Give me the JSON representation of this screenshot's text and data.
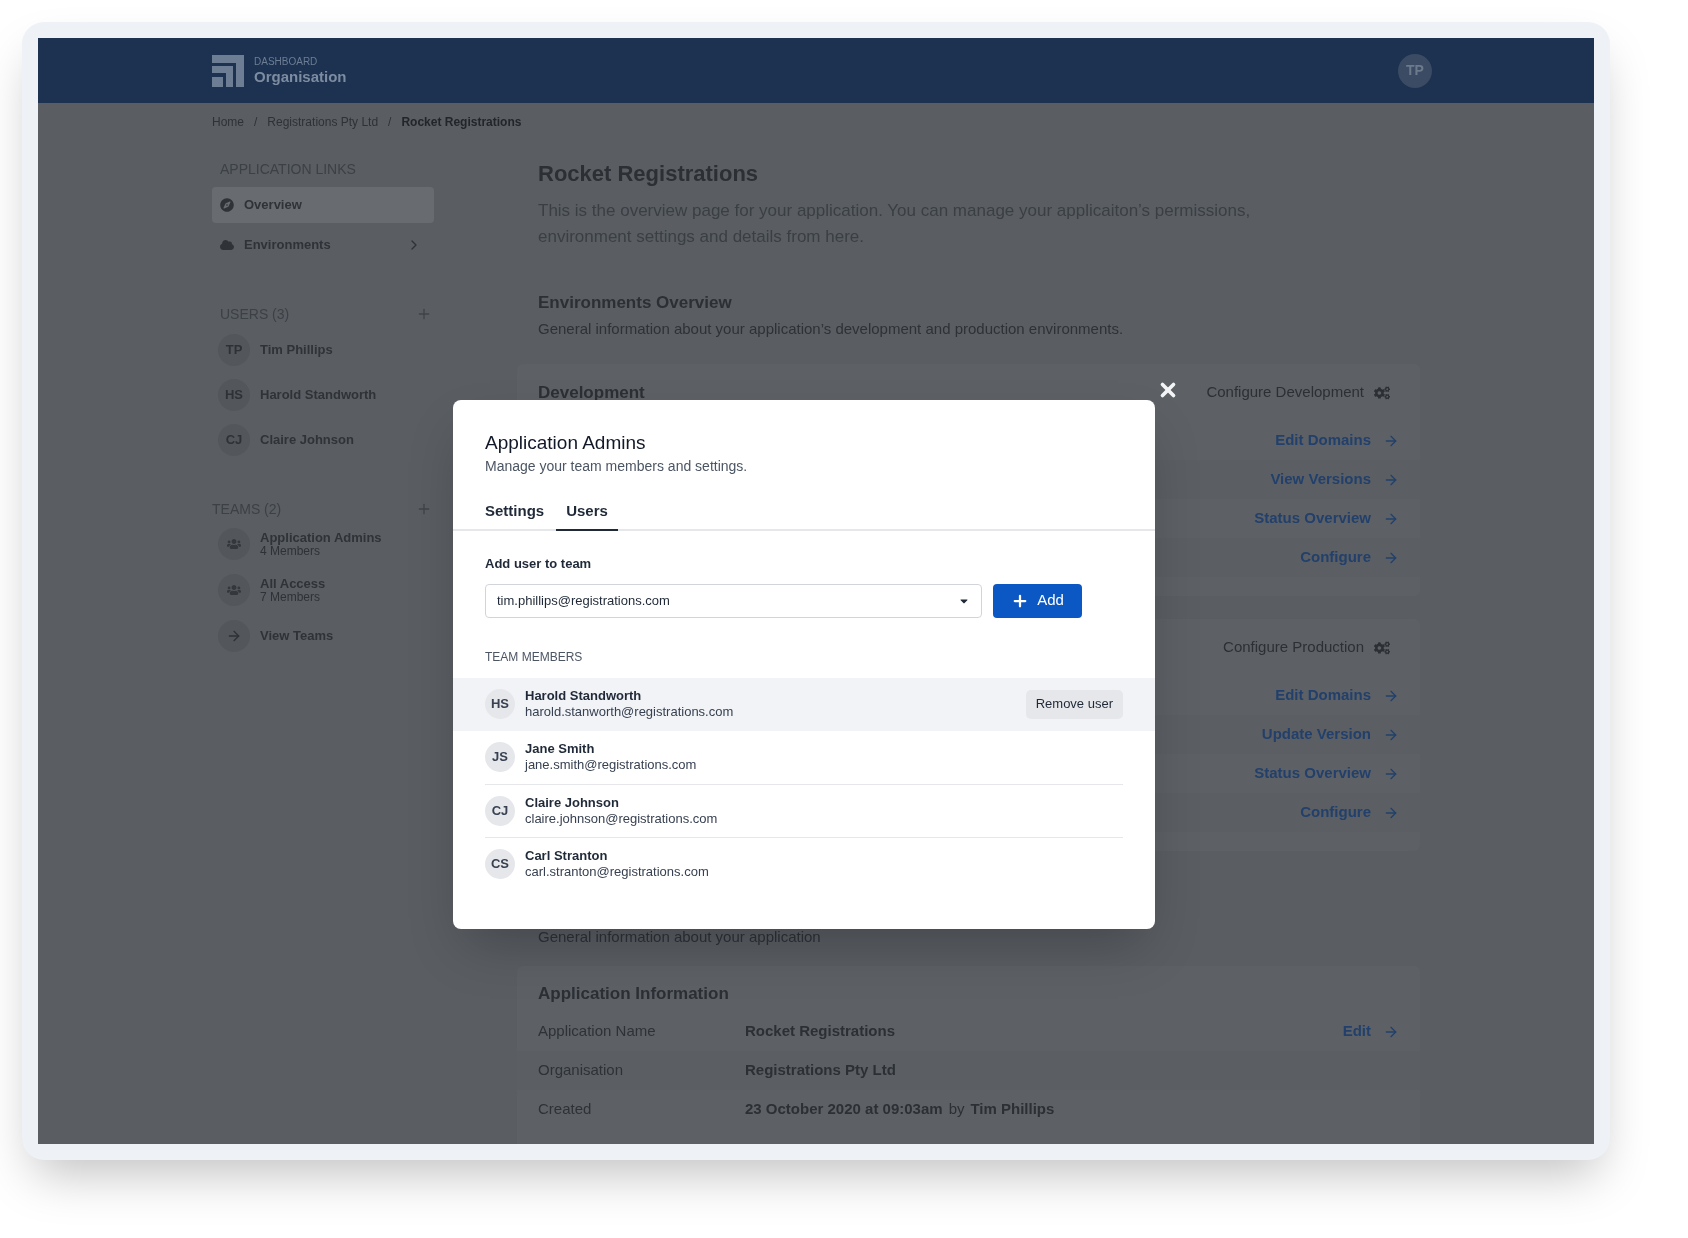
{
  "header": {
    "kicker": "DASHBOARD",
    "title": "Organisation",
    "avatar": "TP"
  },
  "breadcrumb": [
    {
      "label": "Home",
      "current": false
    },
    {
      "separator": "/",
      "label": "Registrations Pty Ltd",
      "current": false
    },
    {
      "separator": "/",
      "label": "Rocket Registrations",
      "current": true
    }
  ],
  "sidebar": {
    "links_title": "APPLICATION LINKS",
    "links": [
      {
        "label": "Overview",
        "selected": true,
        "expandable": false
      },
      {
        "label": "Environments",
        "selected": false,
        "expandable": true
      }
    ],
    "users_title": "USERS (3)",
    "users": [
      {
        "initials": "TP",
        "name": "Tim Phillips"
      },
      {
        "initials": "HS",
        "name": "Harold Standworth"
      },
      {
        "initials": "CJ",
        "name": "Claire Johnson"
      }
    ],
    "teams_title": "TEAMS (2)",
    "teams": [
      {
        "kind": "team",
        "name": "Application Admins",
        "members": "4 Members"
      },
      {
        "kind": "team",
        "name": "All Access",
        "members": "7 Members"
      },
      {
        "kind": "link",
        "name": "View Teams"
      }
    ]
  },
  "main": {
    "title": "Rocket Registrations",
    "intro": "This is the overview page for your application. You can manage your applicaiton’s permissions, environment settings and details from here.",
    "env_title": "Environments Overview",
    "env_description": "General information about your application’s development and production environments.",
    "environments": [
      {
        "title": "Development",
        "action": "Configure Development",
        "links": [
          "Edit Domains",
          "View Versions",
          "Status Overview",
          "Configure"
        ]
      },
      {
        "action": "Configure Production",
        "links": [
          "Edit Domains",
          "Update Version",
          "Status Overview",
          "Configure"
        ]
      }
    ],
    "details_description": "General information about your application",
    "info": {
      "title": "Application Information",
      "rows": [
        {
          "label": "Application Name",
          "value": [
            "**Rocket Registrations**"
          ],
          "link": "Edit"
        },
        {
          "label": "Organisation",
          "value": [
            "**Registrations Pty Ltd**"
          ]
        },
        {
          "label": "Created",
          "value": [
            "**23 October 2020 at 09:03am**",
            "by",
            "**Tim Phillips**"
          ]
        }
      ]
    }
  },
  "modal": {
    "title": "Application Admins",
    "subtitle": "Manage your team members and settings.",
    "tabs": [
      {
        "label": "Settings",
        "selected": false
      },
      {
        "label": "Users",
        "selected": true
      }
    ],
    "add_label": "Add user to team",
    "select_value": "tim.phillips@registrations.com",
    "add_button": "Add",
    "members_title": "TEAM MEMBERS",
    "members": [
      {
        "initials": "HS",
        "name": "Harold Standworth",
        "email": "harold.stanworth@registrations.com",
        "hovered": true,
        "action": "Remove user"
      },
      {
        "initials": "JS",
        "name": "Jane Smith",
        "email": "jane.smith@registrations.com",
        "hovered": false
      },
      {
        "initials": "CJ",
        "name": "Claire Johnson",
        "email": "claire.johnson@registrations.com",
        "hovered": false
      },
      {
        "initials": "CS",
        "name": "Carl Stranton",
        "email": "carl.stranton@registrations.com",
        "hovered": false
      }
    ]
  }
}
